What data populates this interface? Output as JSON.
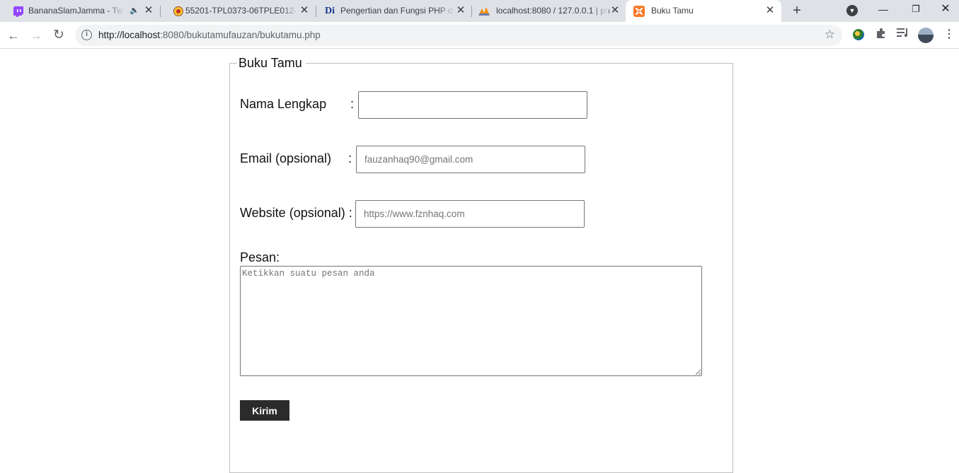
{
  "browser": {
    "tabs": [
      {
        "title": "BananaSlamJamma - Twit",
        "favicon": "twitch-icon",
        "audio": true
      },
      {
        "title": "55201-TPL0373-06TPLE012-2",
        "favicon": "university-seal-icon",
        "audio": false
      },
      {
        "title": "Pengertian dan Fungsi PHP da",
        "favicon": "di-logo",
        "favicon_text": "Di",
        "audio": false
      },
      {
        "title": "localhost:8080 / 127.0.0.1 | ph",
        "favicon": "phpmyadmin-icon",
        "audio": false
      },
      {
        "title": "Buku Tamu",
        "favicon": "xampp-icon",
        "active": true
      }
    ],
    "url_host": "http://localhost",
    "url_rest": ":8080/bukutamufauzan/bukutamu.php",
    "colors": {
      "tabstrip": "#dee1e6",
      "twitch": "#9146ff",
      "xampp": "#fb7a24"
    }
  },
  "form": {
    "legend": "Buku Tamu",
    "name_label": "Nama Lengkap",
    "name_colon": ":",
    "name_value": "",
    "email_label": "Email (opsional)",
    "email_colon": ":",
    "email_placeholder": "fauzanhaq90@gmail.com",
    "website_label": "Website (opsional) :",
    "website_placeholder": "https://www.fznhaq.com",
    "message_label": "Pesan:",
    "message_placeholder": "Ketikkan suatu pesan anda",
    "submit_label": "Kirim",
    "colors": {
      "button": "#2b2b2b",
      "border": "#767676"
    }
  }
}
